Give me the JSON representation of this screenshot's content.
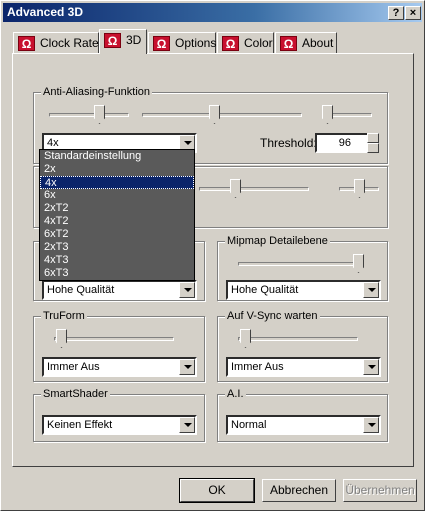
{
  "window": {
    "title": "Advanced 3D",
    "help_btn": "?",
    "close_btn": "×"
  },
  "tabs": [
    {
      "label": "Clock Rate",
      "active": false
    },
    {
      "label": "3D",
      "active": true
    },
    {
      "label": "Options",
      "active": false
    },
    {
      "label": "Color",
      "active": false
    },
    {
      "label": "About",
      "active": false
    }
  ],
  "tab_icon_glyph": "Ω",
  "antialiasing": {
    "title": "Anti-Aliasing-Funktion",
    "mode_value": "4x",
    "threshold_label": "Threshold:",
    "threshold_value": "96",
    "dropdown_options": [
      "Standardeinstellung",
      "2x",
      "4x",
      "6x",
      "2xT2",
      "4xT2",
      "6xT2",
      "2xT3",
      "4xT3",
      "6xT3"
    ],
    "dropdown_selected": "4x"
  },
  "texture_quality": {
    "value": "Hohe Qualität"
  },
  "mipmap": {
    "title": "Mipmap Detailebene",
    "value": "Hohe Qualität"
  },
  "truform": {
    "title": "TruForm",
    "value": "Immer Aus"
  },
  "vsync": {
    "title": "Auf V-Sync warten",
    "value": "Immer Aus"
  },
  "smartshader": {
    "title": "SmartShader",
    "value": "Keinen Effekt"
  },
  "ai": {
    "title": "A.I.",
    "value": "Normal"
  },
  "buttons": {
    "ok": "OK",
    "cancel": "Abbrechen",
    "apply": "Übernehmen"
  }
}
